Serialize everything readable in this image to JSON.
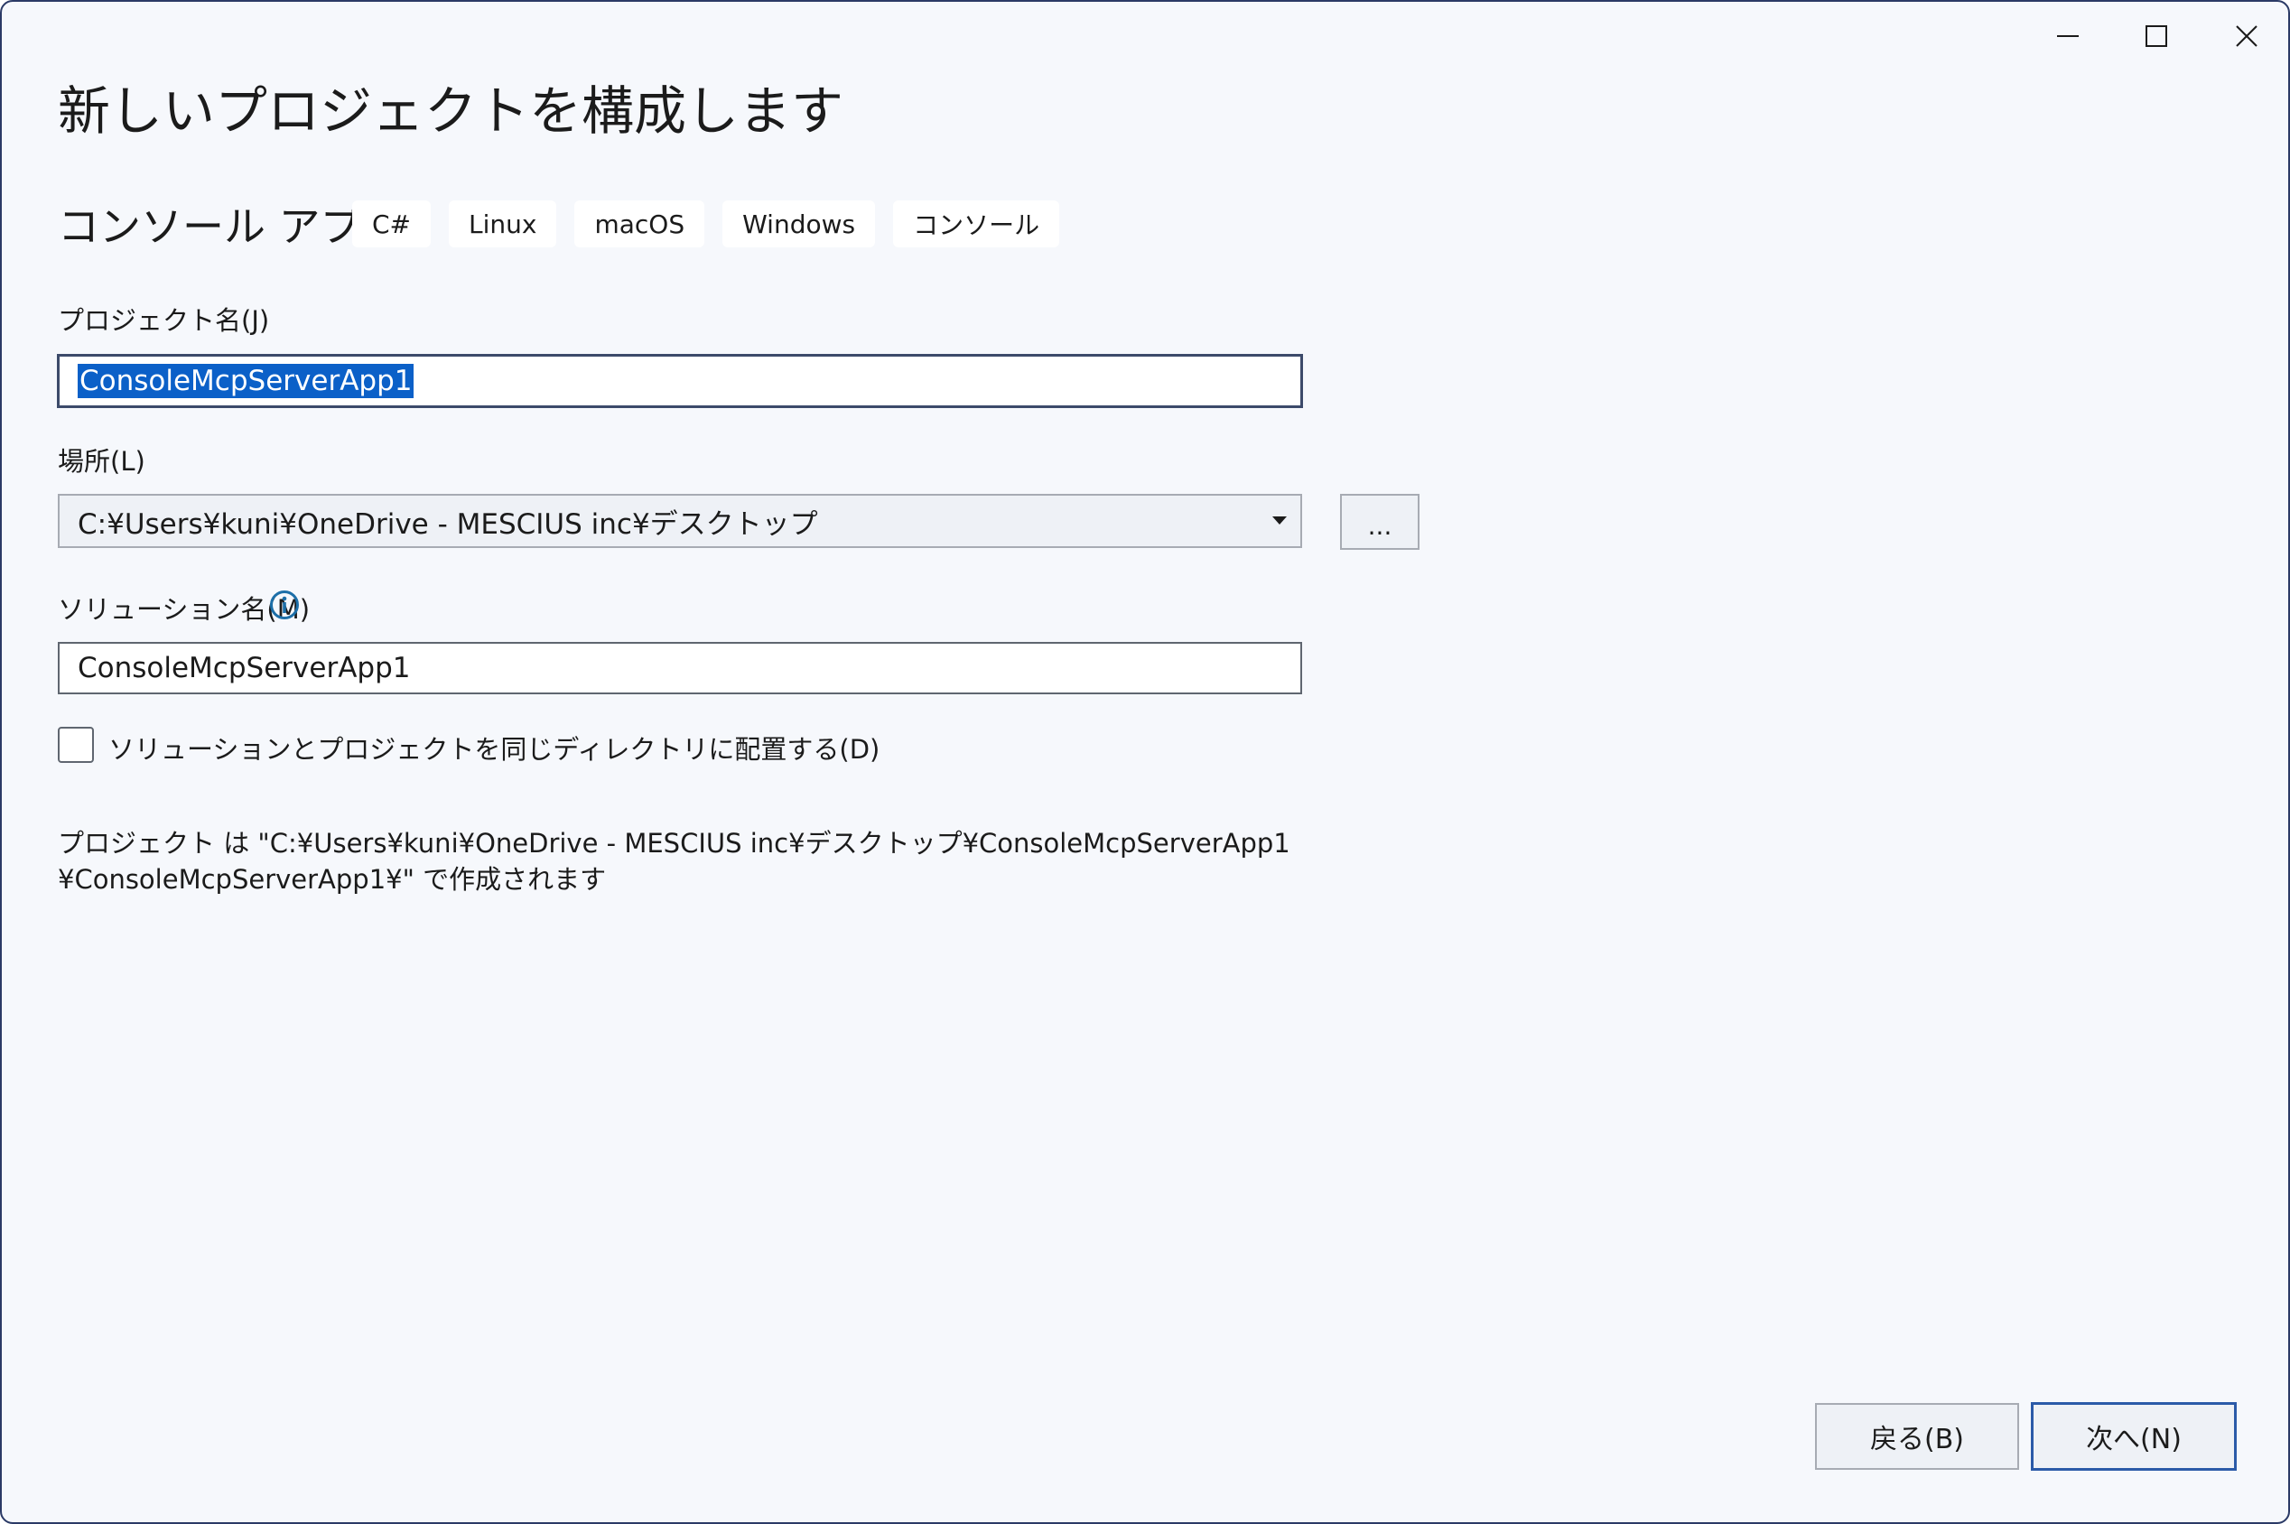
{
  "window": {
    "controls": {
      "minimize_icon": "minimize-icon",
      "maximize_icon": "maximize-icon",
      "close_icon": "close-icon"
    }
  },
  "page": {
    "title": "新しいプロジェクトを構成します",
    "template_name": "コンソール アプリ",
    "tags": [
      "C#",
      "Linux",
      "macOS",
      "Windows",
      "コンソール"
    ]
  },
  "form": {
    "project_name": {
      "label": "プロジェクト名(J)",
      "value": "ConsoleMcpServerApp1"
    },
    "location": {
      "label": "場所(L)",
      "value": "C:¥Users¥kuni¥OneDrive - MESCIUS inc¥デスクトップ",
      "browse_label": "..."
    },
    "solution_name": {
      "label": "ソリューション名(M)",
      "value": "ConsoleMcpServerApp1",
      "info_icon": "info-icon"
    },
    "same_directory": {
      "label": "ソリューションとプロジェクトを同じディレクトリに配置する(D)",
      "checked": false
    }
  },
  "path_info": {
    "line1": "プロジェクト は \"C:¥Users¥kuni¥OneDrive - MESCIUS inc¥デスクトップ¥ConsoleMcpServerApp1",
    "line2": "¥ConsoleMcpServerApp1¥\" で作成されます"
  },
  "footer": {
    "back_label": "戻る(B)",
    "next_label": "次へ(N)"
  },
  "colors": {
    "accent": "#0b60c8",
    "info_icon": "#1d6fa8",
    "window_border": "#2b3a66",
    "background": "#f6f8fc"
  }
}
